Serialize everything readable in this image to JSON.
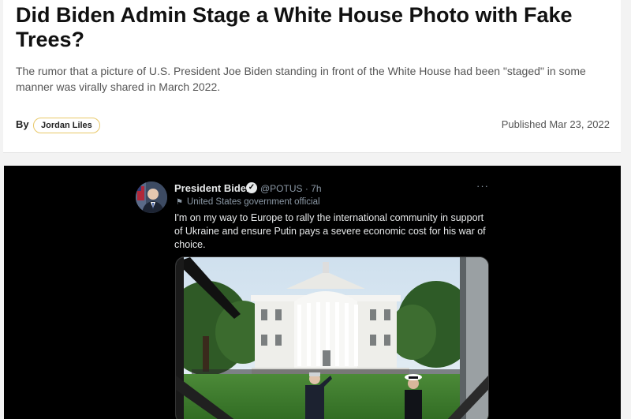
{
  "article": {
    "title": "Did Biden Admin Stage a White House Photo with Fake Trees?",
    "summary": "The rumor that a picture of U.S. President Joe Biden standing in front of the White House had been \"staged\" in some manner was virally shared in March 2022.",
    "byline_prefix": "By",
    "author": "Jordan Liles",
    "published": "Published Mar 23, 2022"
  },
  "tweet": {
    "display_name": "President Biden",
    "verified_mark": "✓",
    "handle_time": "@POTUS · 7h",
    "account_label": "United States government official",
    "text": "I'm on my way to Europe to rally the international community in support of Ukraine and ensure Putin pays a severe economic cost for his war of choice.",
    "more_icon": "ellipsis-icon",
    "flag_icon": "flag-icon"
  },
  "colors": {
    "title": "#111111",
    "body_text": "#555555",
    "author_border": "#e8c868",
    "image_bg": "#000000",
    "tweet_text": "#e7e9ea",
    "tweet_meta": "#8b98a5"
  }
}
